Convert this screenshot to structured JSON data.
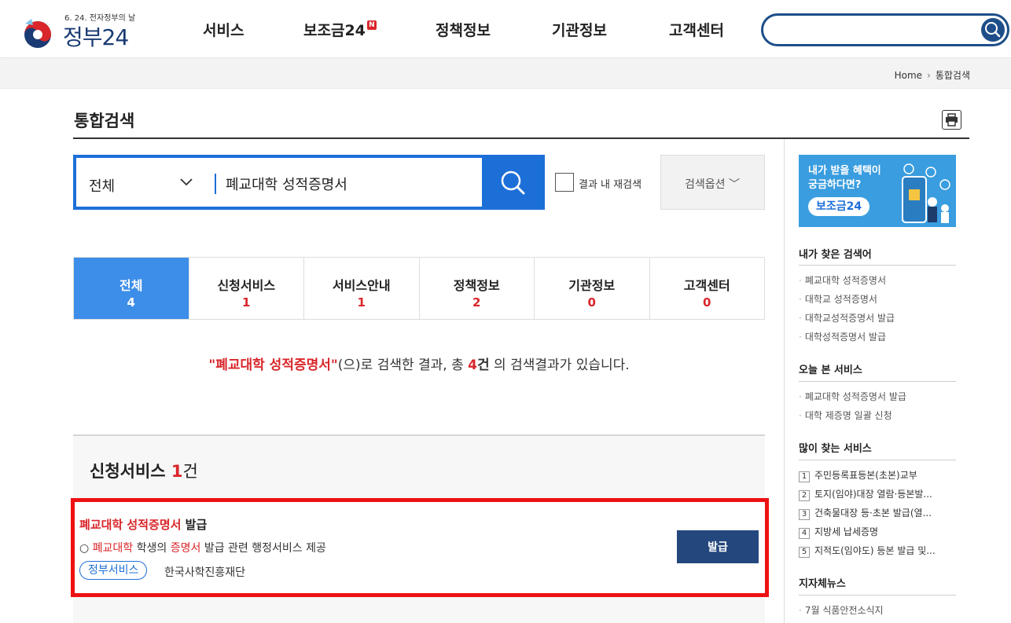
{
  "header": {
    "logo_sub": "6. 24. 전자정부의 날",
    "logo_title": "정부24",
    "nav": [
      {
        "label": "서비스"
      },
      {
        "label": "보조금24",
        "badge": "N"
      },
      {
        "label": "정책정보"
      },
      {
        "label": "기관정보"
      },
      {
        "label": "고객센터"
      }
    ],
    "search_placeholder": ""
  },
  "breadcrumb": {
    "home": "Home",
    "current": "통합검색"
  },
  "page_title": "통합검색",
  "search": {
    "scope": "전체",
    "query": "폐교대학 성적증명서",
    "research_label": "결과 내 재검색",
    "options_label": "검색옵션"
  },
  "tabs": [
    {
      "label": "전체",
      "count": "4"
    },
    {
      "label": "신청서비스",
      "count": "1"
    },
    {
      "label": "서비스안내",
      "count": "1"
    },
    {
      "label": "정책정보",
      "count": "2"
    },
    {
      "label": "기관정보",
      "count": "0"
    },
    {
      "label": "고객센터",
      "count": "0"
    }
  ],
  "result_summary": {
    "query_quoted": "\"폐교대학 성적증명서\"",
    "text1": "(으)로 검색한 결과, 총 ",
    "count": "4",
    "unit": "건",
    "text2": " 의 검색결과가 있습니다."
  },
  "section": {
    "title": "신청서비스",
    "count": "1",
    "unit": "건"
  },
  "result": {
    "title_hl": "폐교대학 성적증명서",
    "title_rest": " 발급",
    "desc_prefix": "○ ",
    "desc_hl1": "폐교대학",
    "desc_mid": " 학생의 ",
    "desc_hl2": "증명서",
    "desc_rest": " 발급 관련 행정서비스 제공",
    "tag": "정부서비스",
    "org": "한국사학진흥재단",
    "button": "발급"
  },
  "sidebar": {
    "banner_line1": "내가 받을 혜택이",
    "banner_line2": "궁금하다면?",
    "banner_pill": "보조금24",
    "my_searches_title": "내가 찾은 검색어",
    "my_searches": [
      "폐교대학 성적증명서",
      "대학교 성적증명서",
      "대학교성적증명서 발급",
      "대학성적증명서 발급"
    ],
    "today_title": "오늘 본 서비스",
    "today": [
      "폐교대학 성적증명서 발급",
      "대학 제증명 일괄 신청"
    ],
    "popular_title": "많이 찾는 서비스",
    "popular": [
      {
        "rank": "1",
        "label": "주민등록표등본(초본)교부"
      },
      {
        "rank": "2",
        "label": "토지(임야)대장 열람·등본발..."
      },
      {
        "rank": "3",
        "label": "건축물대장 등·초본 발급(열..."
      },
      {
        "rank": "4",
        "label": "지방세 납세증명"
      },
      {
        "rank": "5",
        "label": "지적도(임야도) 등본 발급 및..."
      }
    ],
    "news_title": "지자체뉴스",
    "news": [
      "7월 식품안전소식지"
    ]
  },
  "colors": {
    "accent_blue": "#1d6fd8",
    "active_tab": "#3d8ee8",
    "highlight_red": "#d9262a",
    "button_navy": "#24487d",
    "card_border": "#ee1111"
  },
  "icons": [
    "search-icon",
    "chevron-down-icon",
    "print-icon",
    "new-badge"
  ]
}
